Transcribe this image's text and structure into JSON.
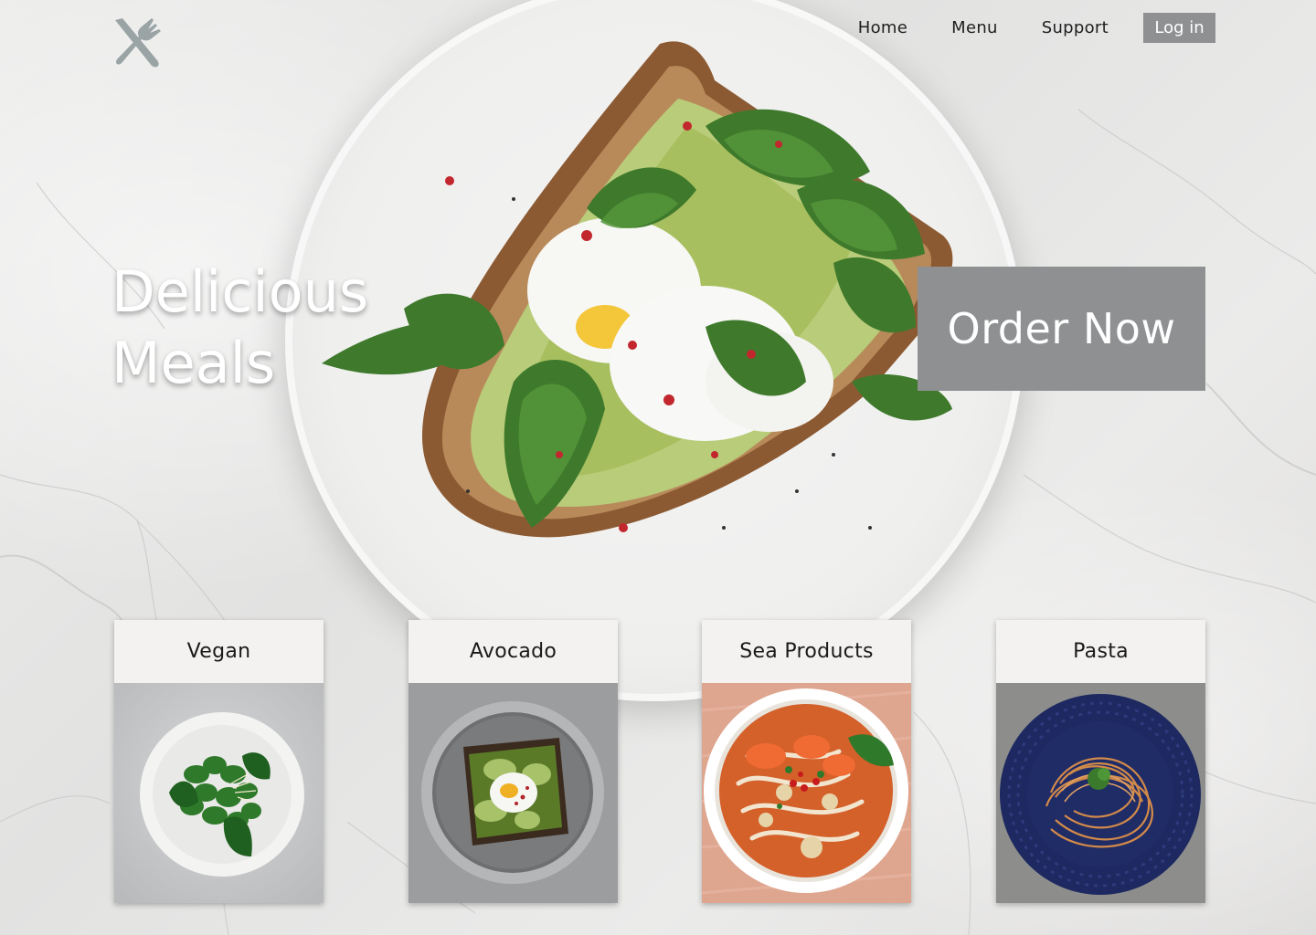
{
  "nav": {
    "home": "Home",
    "menu": "Menu",
    "support": "Support",
    "login": "Log in"
  },
  "hero": {
    "title_line1": "Delicious",
    "title_line2": "Meals",
    "cta": "Order Now"
  },
  "categories": [
    {
      "label": "Vegan",
      "icon": "vegan-dish-image"
    },
    {
      "label": "Avocado",
      "icon": "avocado-toast-image"
    },
    {
      "label": "Sea Products",
      "icon": "seafood-soup-image"
    },
    {
      "label": "Pasta",
      "icon": "pasta-plate-image"
    }
  ],
  "colors": {
    "button_gray": "#8e9092",
    "logo_gray": "#9aa4a5",
    "card_bg": "#f3f2f0"
  }
}
